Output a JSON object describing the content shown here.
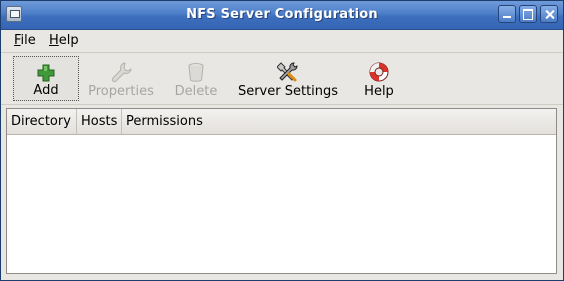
{
  "window": {
    "title": "NFS Server Configuration"
  },
  "menubar": {
    "items": [
      {
        "label": "File"
      },
      {
        "label": "Help"
      }
    ]
  },
  "toolbar": {
    "items": [
      {
        "label": "Add",
        "icon": "plus-icon",
        "enabled": true
      },
      {
        "label": "Properties",
        "icon": "wrench-icon",
        "enabled": false
      },
      {
        "label": "Delete",
        "icon": "trash-icon",
        "enabled": false
      },
      {
        "label": "Server Settings",
        "icon": "tools-icon",
        "enabled": true
      },
      {
        "label": "Help",
        "icon": "lifebuoy-icon",
        "enabled": true
      }
    ]
  },
  "table": {
    "columns": [
      "Directory",
      "Hosts",
      "Permissions"
    ],
    "rows": []
  },
  "colors": {
    "titlebar": "#3d6fbe",
    "window_bg": "#e9e7e3",
    "disabled_text": "#a8a6a2"
  }
}
